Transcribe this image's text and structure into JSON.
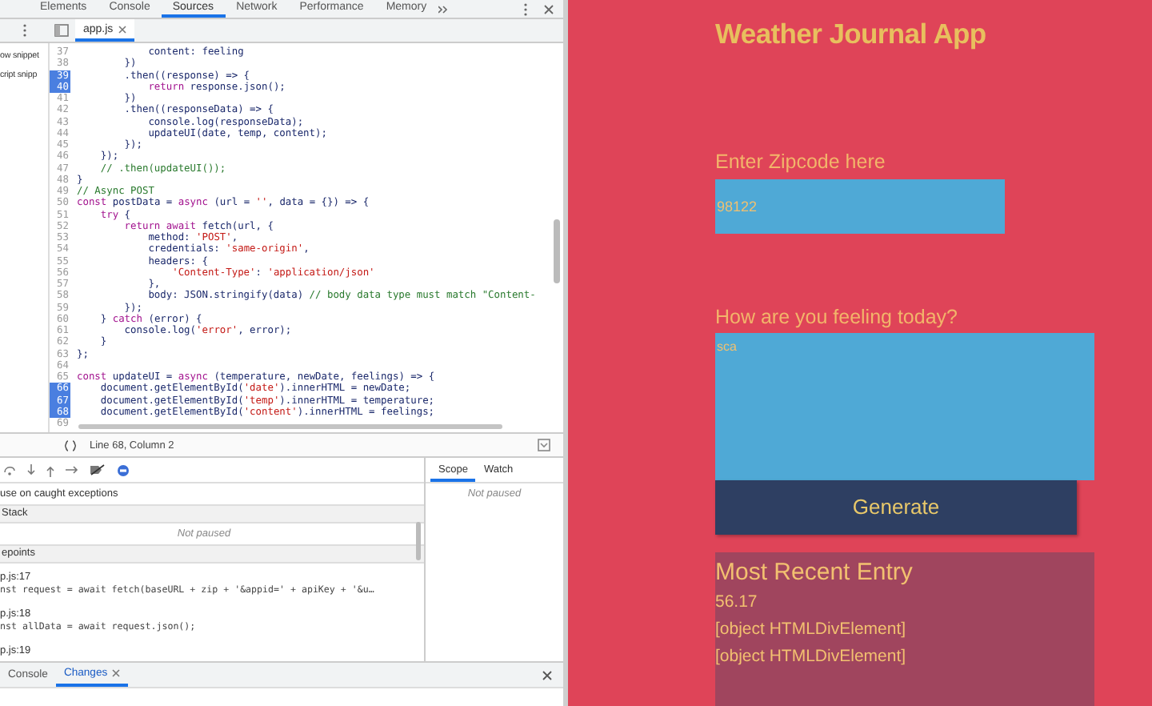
{
  "devtools": {
    "tabs": [
      {
        "label": "Elements",
        "selected": false
      },
      {
        "label": "Console",
        "selected": false
      },
      {
        "label": "Sources",
        "selected": true
      },
      {
        "label": "Network",
        "selected": false
      },
      {
        "label": "Performance",
        "selected": false
      },
      {
        "label": "Memory",
        "selected": false
      }
    ],
    "file_tabs": [
      {
        "label": "app.js",
        "selected": true
      }
    ],
    "navigator": {
      "items": [
        "ow snippet",
        "cript snipp"
      ]
    },
    "code_lines": [
      {
        "number": "37",
        "breakpoint": false,
        "parts": [
          {
            "text": "            content: feeling",
            "kind": "plain"
          }
        ]
      },
      {
        "number": "38",
        "breakpoint": false,
        "parts": [
          {
            "text": "        })",
            "kind": "plain"
          }
        ]
      },
      {
        "number": "39",
        "breakpoint": true,
        "parts": [
          {
            "text": "        .then((response) => {",
            "kind": "plain"
          }
        ]
      },
      {
        "number": "40",
        "breakpoint": true,
        "parts": [
          {
            "text": "            return",
            "kind": "keyword"
          },
          {
            "text": " response.json();",
            "kind": "plain"
          }
        ]
      },
      {
        "number": "41",
        "breakpoint": false,
        "parts": [
          {
            "text": "        })",
            "kind": "plain"
          }
        ]
      },
      {
        "number": "42",
        "breakpoint": false,
        "parts": [
          {
            "text": "        .then((responseData) => {",
            "kind": "plain"
          }
        ]
      },
      {
        "number": "43",
        "breakpoint": false,
        "parts": [
          {
            "text": "            console.log(responseData);",
            "kind": "plain"
          }
        ]
      },
      {
        "number": "44",
        "breakpoint": false,
        "parts": [
          {
            "text": "            updateUI(date, temp, content);",
            "kind": "plain"
          }
        ]
      },
      {
        "number": "45",
        "breakpoint": false,
        "parts": [
          {
            "text": "        });",
            "kind": "plain"
          }
        ]
      },
      {
        "number": "46",
        "breakpoint": false,
        "parts": [
          {
            "text": "    });",
            "kind": "plain"
          }
        ]
      },
      {
        "number": "47",
        "breakpoint": false,
        "parts": [
          {
            "text": "    // .then(updateUI());",
            "kind": "comment"
          }
        ]
      },
      {
        "number": "48",
        "breakpoint": false,
        "parts": [
          {
            "text": "}",
            "kind": "plain"
          }
        ]
      },
      {
        "number": "49",
        "breakpoint": false,
        "parts": [
          {
            "text": "// Async POST",
            "kind": "comment"
          }
        ]
      },
      {
        "number": "50",
        "breakpoint": false,
        "parts": [
          {
            "text": "const",
            "kind": "keyword"
          },
          {
            "text": " postData = ",
            "kind": "plain"
          },
          {
            "text": "async",
            "kind": "keyword"
          },
          {
            "text": " (url = ",
            "kind": "plain"
          },
          {
            "text": "''",
            "kind": "string"
          },
          {
            "text": ", data = {}) => {",
            "kind": "plain"
          }
        ]
      },
      {
        "number": "51",
        "breakpoint": false,
        "parts": [
          {
            "text": "    try",
            "kind": "keyword"
          },
          {
            "text": " {",
            "kind": "plain"
          }
        ]
      },
      {
        "number": "52",
        "breakpoint": false,
        "parts": [
          {
            "text": "        return await",
            "kind": "keyword"
          },
          {
            "text": " fetch(url, {",
            "kind": "plain"
          }
        ]
      },
      {
        "number": "53",
        "breakpoint": false,
        "parts": [
          {
            "text": "            method: ",
            "kind": "plain"
          },
          {
            "text": "'POST'",
            "kind": "string"
          },
          {
            "text": ",",
            "kind": "plain"
          }
        ]
      },
      {
        "number": "54",
        "breakpoint": false,
        "parts": [
          {
            "text": "            credentials: ",
            "kind": "plain"
          },
          {
            "text": "'same-origin'",
            "kind": "string"
          },
          {
            "text": ",",
            "kind": "plain"
          }
        ]
      },
      {
        "number": "55",
        "breakpoint": false,
        "parts": [
          {
            "text": "            headers: {",
            "kind": "plain"
          }
        ]
      },
      {
        "number": "56",
        "breakpoint": false,
        "parts": [
          {
            "text": "                'Content-Type'",
            "kind": "string"
          },
          {
            "text": ": ",
            "kind": "plain"
          },
          {
            "text": "'application/json'",
            "kind": "string"
          }
        ]
      },
      {
        "number": "57",
        "breakpoint": false,
        "parts": [
          {
            "text": "            },",
            "kind": "plain"
          }
        ]
      },
      {
        "number": "58",
        "breakpoint": false,
        "parts": [
          {
            "text": "            body: JSON.stringify(data) ",
            "kind": "plain"
          },
          {
            "text": "// body data type must match \"Content-",
            "kind": "comment"
          }
        ]
      },
      {
        "number": "59",
        "breakpoint": false,
        "parts": [
          {
            "text": "        });",
            "kind": "plain"
          }
        ]
      },
      {
        "number": "60",
        "breakpoint": false,
        "parts": [
          {
            "text": "    } ",
            "kind": "plain"
          },
          {
            "text": "catch",
            "kind": "keyword"
          },
          {
            "text": " (error) {",
            "kind": "plain"
          }
        ]
      },
      {
        "number": "61",
        "breakpoint": false,
        "parts": [
          {
            "text": "        console.log(",
            "kind": "plain"
          },
          {
            "text": "'error'",
            "kind": "string"
          },
          {
            "text": ", error);",
            "kind": "plain"
          }
        ]
      },
      {
        "number": "62",
        "breakpoint": false,
        "parts": [
          {
            "text": "    }",
            "kind": "plain"
          }
        ]
      },
      {
        "number": "63",
        "breakpoint": false,
        "parts": [
          {
            "text": "};",
            "kind": "plain"
          }
        ]
      },
      {
        "number": "64",
        "breakpoint": false
      },
      {
        "number": "65",
        "breakpoint": false,
        "parts": [
          {
            "text": "const",
            "kind": "keyword"
          },
          {
            "text": " updateUI = ",
            "kind": "plain"
          },
          {
            "text": "async",
            "kind": "keyword"
          },
          {
            "text": " (temperature, newDate, feelings) => {",
            "kind": "plain"
          }
        ]
      },
      {
        "number": "66",
        "breakpoint": true,
        "parts": [
          {
            "text": "    document.getElementById(",
            "kind": "plain"
          },
          {
            "text": "'date'",
            "kind": "string"
          },
          {
            "text": ").innerHTML = newDate;",
            "kind": "plain"
          }
        ]
      },
      {
        "number": "67",
        "breakpoint": true,
        "parts": [
          {
            "text": "    document.getElementById(",
            "kind": "plain"
          },
          {
            "text": "'temp'",
            "kind": "string"
          },
          {
            "text": ").innerHTML = temperature;",
            "kind": "plain"
          }
        ]
      },
      {
        "number": "68",
        "breakpoint": true,
        "parts": [
          {
            "text": "    document.getElementById(",
            "kind": "plain"
          },
          {
            "text": "'content'",
            "kind": "string"
          },
          {
            "text": ").innerHTML = feelings;",
            "kind": "plain"
          }
        ]
      },
      {
        "number": "69",
        "breakpoint": false
      }
    ],
    "status_bar": {
      "position": "Line 68, Column 2"
    },
    "debugger": {
      "pause_option": "use on caught exceptions",
      "sections": [
        {
          "title": "Stack",
          "items": [
            {
              "kind": "message",
              "text": "Not paused"
            }
          ]
        },
        {
          "title": "epoints",
          "items": [
            {
              "kind": "location",
              "text": "p.js:17"
            },
            {
              "kind": "code",
              "text": "nst request = await fetch(baseURL + zip + '&appid=' + apiKey + '&u…"
            },
            {
              "kind": "location",
              "text": "p.js:18"
            },
            {
              "kind": "code",
              "text": "nst allData = await request.json();"
            },
            {
              "kind": "location",
              "text": "p.js:19"
            }
          ]
        }
      ],
      "side_tabs": [
        {
          "label": "Scope",
          "selected": true
        },
        {
          "label": "Watch",
          "selected": false
        }
      ],
      "side_message": "Not paused"
    },
    "drawer_tabs": [
      {
        "label": "Console",
        "selected": false
      },
      {
        "label": "Changes",
        "selected": true
      }
    ]
  },
  "app": {
    "title": "Weather Journal App",
    "zip_label": "Enter Zipcode here",
    "zip_value": "98122",
    "feelings_label": "How are you feeling today?",
    "feelings_value": "sca",
    "button": "Generate",
    "entry": {
      "title": "Most Recent Entry",
      "lines": [
        "56.17",
        "[object HTMLDivElement]",
        "[object HTMLDivElement]"
      ]
    }
  }
}
